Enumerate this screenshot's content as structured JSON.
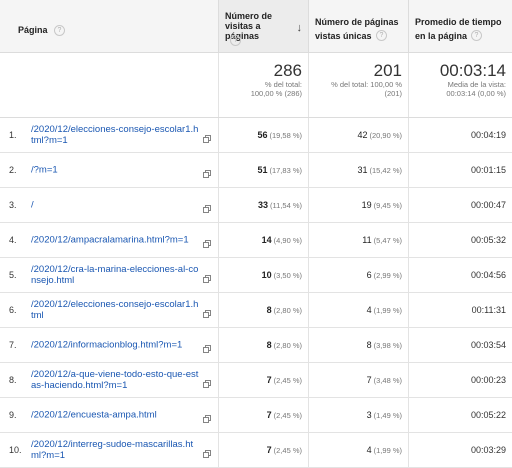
{
  "header": {
    "col_page": "Página",
    "col_pageviews": "Número de visitas a páginas",
    "col_unique": "Número de páginas vistas únicas",
    "col_avgtime": "Promedio de tiempo en la página",
    "sort_arrow": "↓"
  },
  "totals": {
    "pageviews": "286",
    "pageviews_sub1": "% del total:",
    "pageviews_sub2": "100,00 % (286)",
    "unique": "201",
    "unique_sub1": "% del total: 100,00 %",
    "unique_sub2": "(201)",
    "avgtime": "00:03:14",
    "avgtime_sub1": "Media de la vista:",
    "avgtime_sub2": "00:03:14 (0,00 %)"
  },
  "rows": [
    {
      "n": "1.",
      "page": "/2020/12/elecciones-consejo-escolar1.html?m=1",
      "pv": "56",
      "pv_pct": "(19,58 %)",
      "uv": "42",
      "uv_pct": "(20,90 %)",
      "time": "00:04:19"
    },
    {
      "n": "2.",
      "page": "/?m=1",
      "pv": "51",
      "pv_pct": "(17,83 %)",
      "uv": "31",
      "uv_pct": "(15,42 %)",
      "time": "00:01:15"
    },
    {
      "n": "3.",
      "page": "/",
      "pv": "33",
      "pv_pct": "(11,54 %)",
      "uv": "19",
      "uv_pct": "(9,45 %)",
      "time": "00:00:47"
    },
    {
      "n": "4.",
      "page": "/2020/12/ampacralamarina.html?m=1",
      "pv": "14",
      "pv_pct": "(4,90 %)",
      "uv": "11",
      "uv_pct": "(5,47 %)",
      "time": "00:05:32"
    },
    {
      "n": "5.",
      "page": "/2020/12/cra-la-marina-elecciones-al-consejo.html",
      "pv": "10",
      "pv_pct": "(3,50 %)",
      "uv": "6",
      "uv_pct": "(2,99 %)",
      "time": "00:04:56"
    },
    {
      "n": "6.",
      "page": "/2020/12/elecciones-consejo-escolar1.html",
      "pv": "8",
      "pv_pct": "(2,80 %)",
      "uv": "4",
      "uv_pct": "(1,99 %)",
      "time": "00:11:31"
    },
    {
      "n": "7.",
      "page": "/2020/12/informacionblog.html?m=1",
      "pv": "8",
      "pv_pct": "(2,80 %)",
      "uv": "8",
      "uv_pct": "(3,98 %)",
      "time": "00:03:54"
    },
    {
      "n": "8.",
      "page": "/2020/12/a-que-viene-todo-esto-que-estas-haciendo.html?m=1",
      "pv": "7",
      "pv_pct": "(2,45 %)",
      "uv": "7",
      "uv_pct": "(3,48 %)",
      "time": "00:00:23"
    },
    {
      "n": "9.",
      "page": "/2020/12/encuesta-ampa.html",
      "pv": "7",
      "pv_pct": "(2,45 %)",
      "uv": "3",
      "uv_pct": "(1,49 %)",
      "time": "00:05:22"
    },
    {
      "n": "10.",
      "page": "/2020/12/interreg-sudoe-mascarillas.html?m=1",
      "pv": "7",
      "pv_pct": "(2,45 %)",
      "uv": "4",
      "uv_pct": "(1,99 %)",
      "time": "00:03:29"
    }
  ]
}
